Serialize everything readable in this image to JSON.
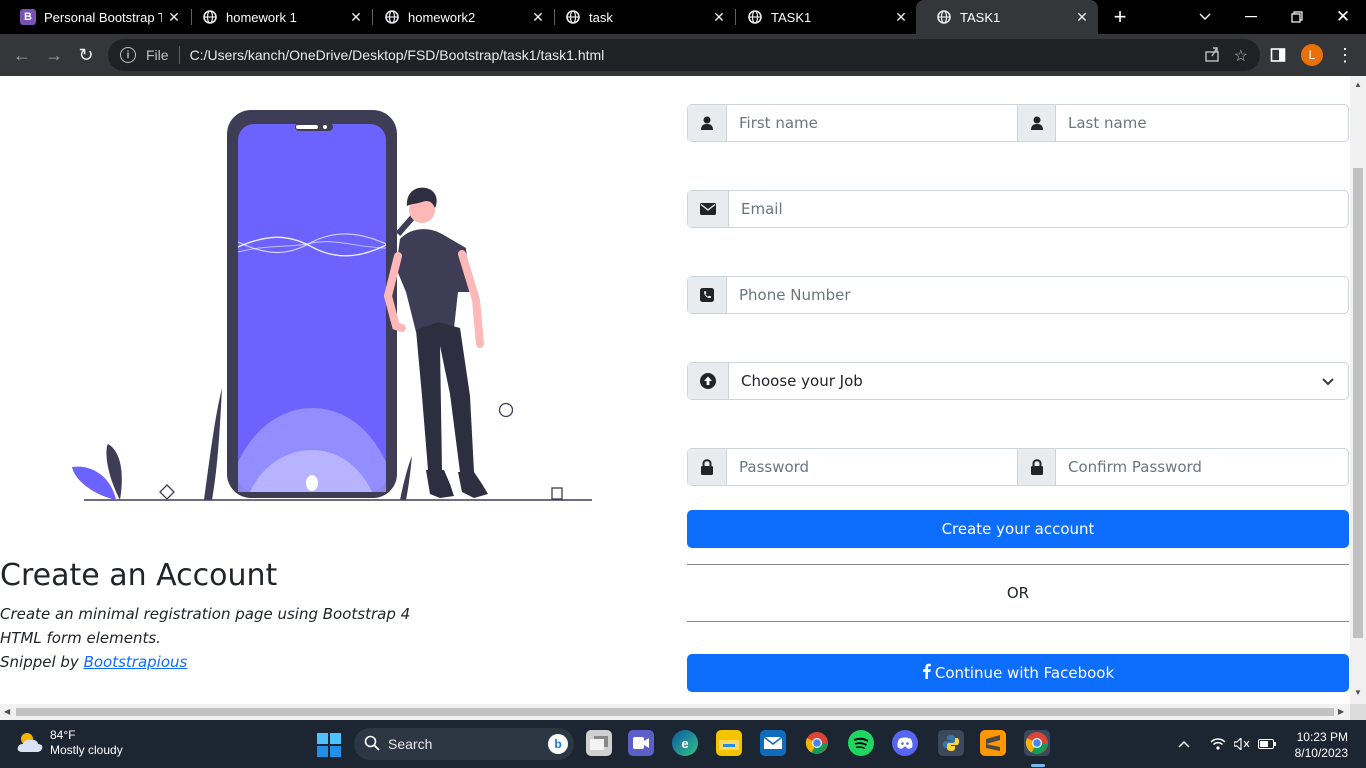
{
  "browser": {
    "tabs": [
      {
        "title": "Personal Bootstrap Te",
        "favicon": "bootstrap-icon"
      },
      {
        "title": "homework 1",
        "favicon": "globe-icon"
      },
      {
        "title": "homework2",
        "favicon": "globe-icon"
      },
      {
        "title": "task",
        "favicon": "globe-icon"
      },
      {
        "title": "TASK1",
        "favicon": "globe-icon"
      },
      {
        "title": "TASK1",
        "favicon": "globe-icon",
        "active": true
      }
    ],
    "address": {
      "scheme_label": "File",
      "url": "C:/Users/kanch/OneDrive/Desktop/FSD/Bootstrap/task1/task1.html"
    },
    "profile_initial": "L",
    "favicon_letter": "B"
  },
  "page": {
    "heading": "Create an Account",
    "description_line1": "Create an minimal registration page using Bootstrap 4",
    "description_line2": "HTML form elements.",
    "snippet_prefix": "Snippel by ",
    "snippet_link": "Bootstrapious",
    "form": {
      "first_name_placeholder": "First name",
      "last_name_placeholder": "Last name",
      "email_placeholder": "Email",
      "phone_placeholder": "Phone Number",
      "job_select_value": "Choose your Job",
      "password_placeholder": "Password",
      "confirm_password_placeholder": "Confirm Password",
      "submit_label": "Create your account",
      "divider_text": "OR",
      "facebook_label": "Continue with Facebook"
    },
    "colors": {
      "primary": "#0d6efd",
      "phone_screen": "#6c63ff",
      "phone_body": "#3f3d56"
    }
  },
  "taskbar": {
    "weather_temp": "84°F",
    "weather_desc": "Mostly cloudy",
    "search_label": "Search",
    "time": "10:23 PM",
    "date": "8/10/2023"
  }
}
